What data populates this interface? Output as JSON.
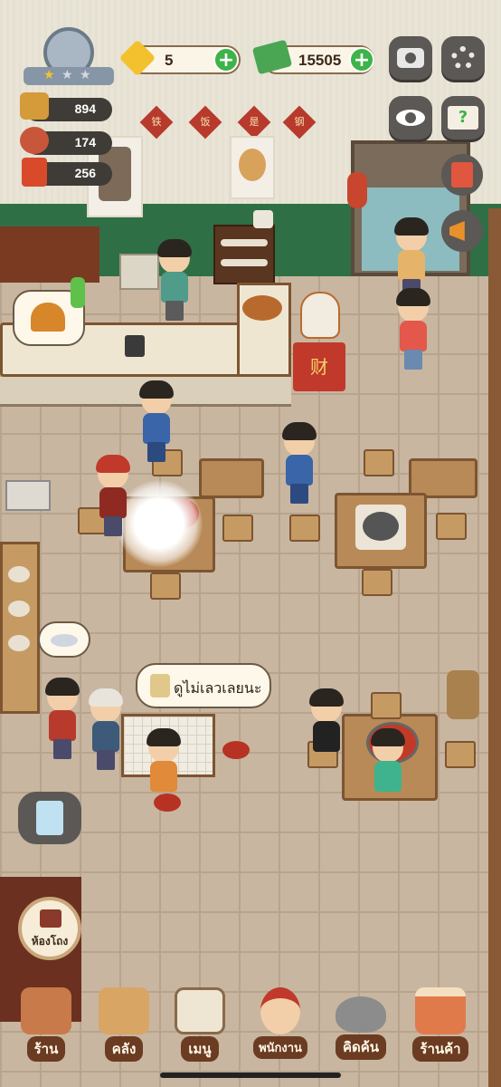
{
  "hud": {
    "gems": "5",
    "cash": "15505",
    "resources": [
      {
        "name": "noodle-resource",
        "value": "894"
      },
      {
        "name": "meat-resource",
        "value": "174"
      },
      {
        "name": "book-resource",
        "value": "256"
      }
    ]
  },
  "wall_signs": [
    "铁",
    "饭",
    "是",
    "钢"
  ],
  "speech_bubble": "ดูไม่เลวเลยนะ",
  "side_buttons": {
    "private_room": "ห้องโถง"
  },
  "lucky_cat_sign": "财",
  "nav": [
    {
      "key": "shop",
      "label": "ร้าน",
      "icon": "shop-house-icon"
    },
    {
      "key": "storage",
      "label": "คลัง",
      "icon": "boxes-icon"
    },
    {
      "key": "menu",
      "label": "เมนู",
      "icon": "clipboard-menu-icon"
    },
    {
      "key": "staff",
      "label": "พนักงาน",
      "icon": "staff-chef-icon"
    },
    {
      "key": "recipe",
      "label": "คิดค้น",
      "icon": "wok-icon"
    },
    {
      "key": "store",
      "label": "ร้านค้า",
      "icon": "store-stall-icon"
    }
  ],
  "colors": {
    "wall_green": "#2f6f45",
    "floor": "#c8b6a0",
    "plus_green": "#3db349",
    "nav_label_bg": "#6b3b22"
  }
}
